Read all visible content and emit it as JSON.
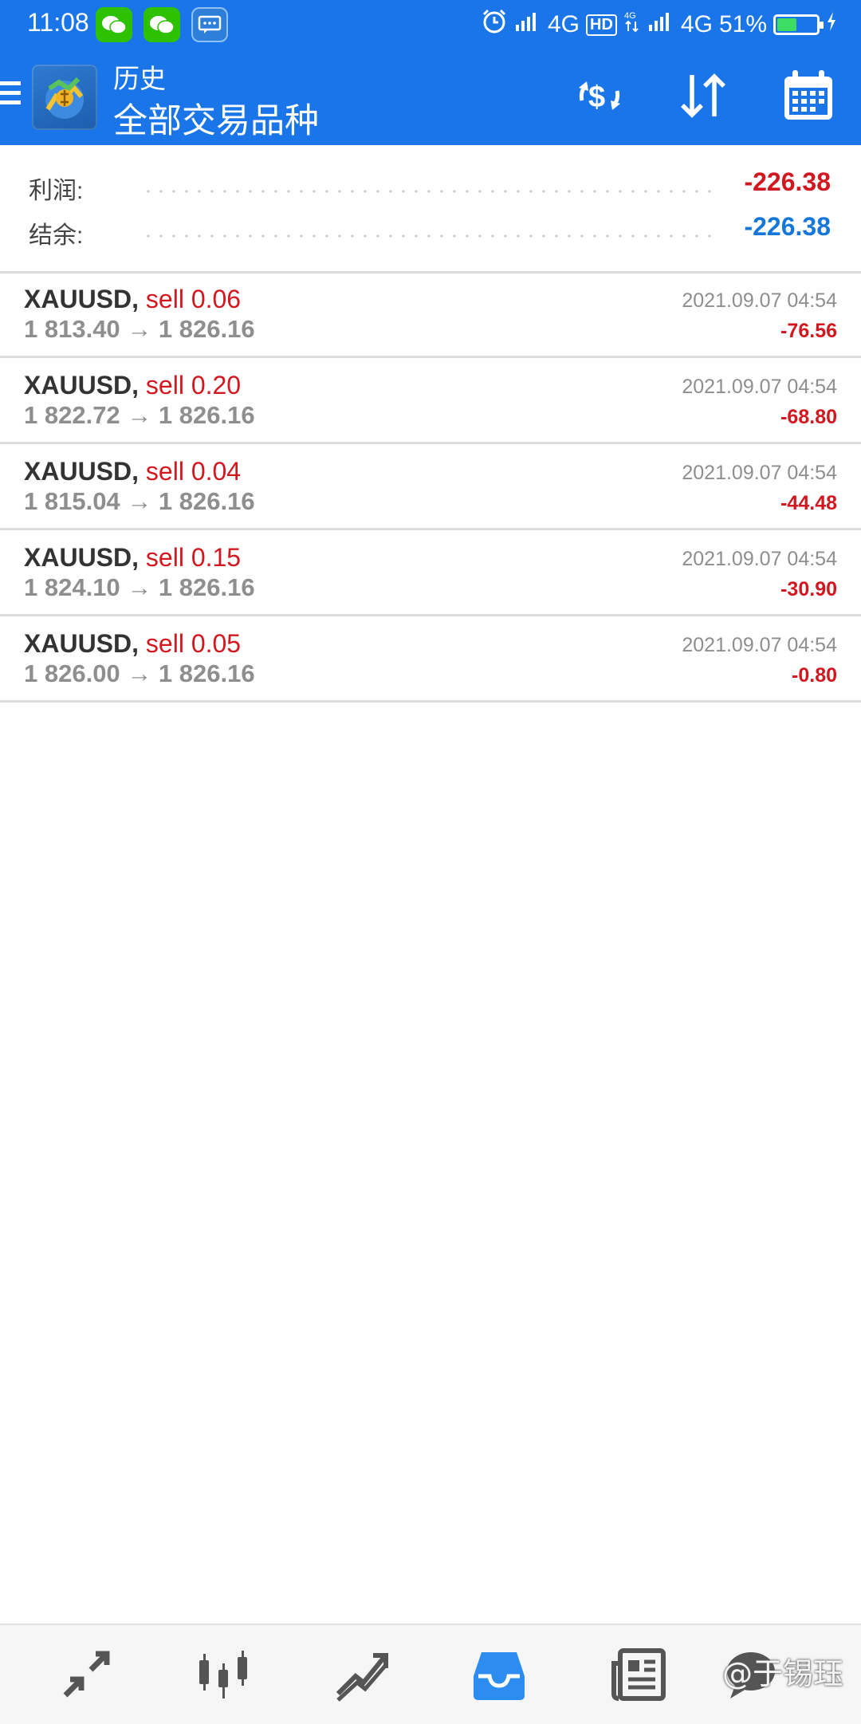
{
  "status_bar": {
    "time": "11:08",
    "network_1": "4G",
    "hd_badge": "HD",
    "network_2": "4G",
    "battery_percent": "51%",
    "battery_level": 0.51
  },
  "app_bar": {
    "title_small": "历史",
    "title_big": "全部交易品种"
  },
  "summary": {
    "profit_label": "利润:",
    "profit_value": "-226.38",
    "balance_label": "结余:",
    "balance_value": "-226.38"
  },
  "trades": [
    {
      "symbol": "XAUUSD,",
      "type": "sell 0.06",
      "prices": "1 813.40 → 1 826.16",
      "time": "2021.09.07 04:54",
      "profit": "-76.56"
    },
    {
      "symbol": "XAUUSD,",
      "type": "sell 0.20",
      "prices": "1 822.72 → 1 826.16",
      "time": "2021.09.07 04:54",
      "profit": "-68.80"
    },
    {
      "symbol": "XAUUSD,",
      "type": "sell 0.04",
      "prices": "1 815.04 → 1 826.16",
      "time": "2021.09.07 04:54",
      "profit": "-44.48"
    },
    {
      "symbol": "XAUUSD,",
      "type": "sell 0.15",
      "prices": "1 824.10 → 1 826.16",
      "time": "2021.09.07 04:54",
      "profit": "-30.90"
    },
    {
      "symbol": "XAUUSD,",
      "type": "sell 0.05",
      "prices": "1 826.00 → 1 826.16",
      "time": "2021.09.07 04:54",
      "profit": "-0.80"
    }
  ],
  "bottom_nav": {
    "items": [
      "quotes-icon",
      "chart-icon",
      "trade-icon",
      "history-icon",
      "news-icon",
      "chat-icon"
    ],
    "active": "history-icon"
  },
  "watermark": "@于锡珏",
  "colors": {
    "header_blue": "#1a76e8",
    "loss_red": "#d1171f",
    "balance_blue": "#1677db",
    "active_nav": "#2d8cf0"
  }
}
